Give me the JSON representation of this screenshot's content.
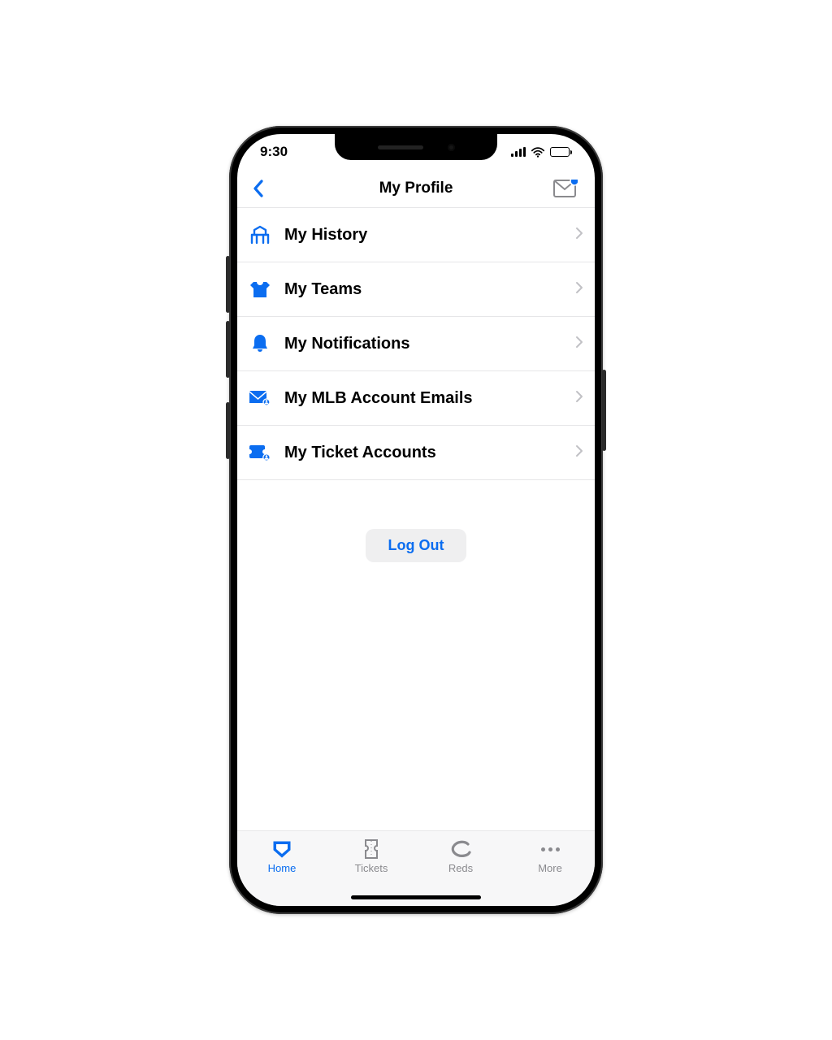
{
  "status": {
    "time": "9:30"
  },
  "header": {
    "title": "My Profile"
  },
  "menu": {
    "items": [
      {
        "label": "My History",
        "icon": "stadium-icon"
      },
      {
        "label": "My Teams",
        "icon": "jersey-icon"
      },
      {
        "label": "My Notifications",
        "icon": "bell-icon"
      },
      {
        "label": "My MLB Account Emails",
        "icon": "mail-user-icon"
      },
      {
        "label": "My Ticket Accounts",
        "icon": "ticket-user-icon"
      }
    ]
  },
  "logout_label": "Log Out",
  "tabs": {
    "items": [
      {
        "label": "Home",
        "active": true
      },
      {
        "label": "Tickets",
        "active": false
      },
      {
        "label": "Reds",
        "active": false
      },
      {
        "label": "More",
        "active": false
      }
    ]
  },
  "colors": {
    "accent": "#0b6df0",
    "inactive": "#8a8a8e"
  }
}
